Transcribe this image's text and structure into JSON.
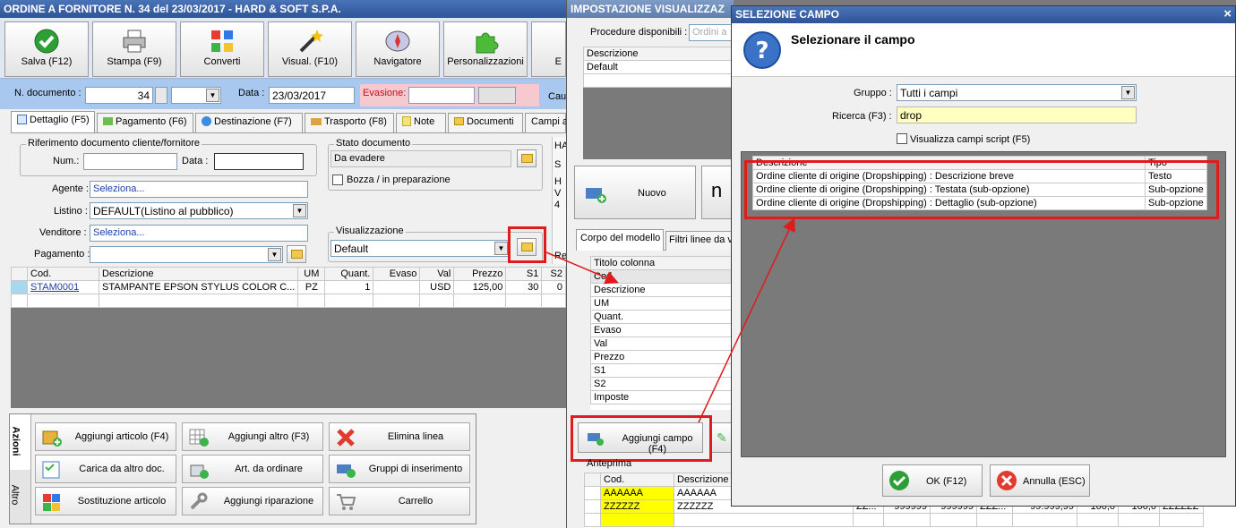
{
  "main_window": {
    "title": "ORDINE A FORNITORE N. 34 del 23/03/2017 - HARD & SOFT S.P.A.",
    "toolbar": {
      "save": "Salva (F12)",
      "print": "Stampa (F9)",
      "convert": "Converti",
      "visual": "Visual. (F10)",
      "navigator": "Navigatore",
      "custom": "Personalizzazioni",
      "extra": "E"
    },
    "header": {
      "doc_number_label": "N. documento :",
      "doc_number": "34",
      "date_label": "Data :",
      "date": "23/03/2017",
      "evasion_label": "Evasione:",
      "cau_label": "Cau"
    },
    "tabs": [
      "Dettaglio (F5)",
      "Pagamento (F6)",
      "Destinazione (F7)",
      "Trasporto (F8)",
      "Note",
      "Documenti",
      "Campi a"
    ],
    "ref_group": {
      "title": "Riferimento documento cliente/fornitore",
      "num_label": "Num.:",
      "date_label": "Data :"
    },
    "agente_label": "Agente :",
    "agente_value": "Seleziona...",
    "listino_label": "Listino :",
    "listino_value": "DEFAULT(Listino al pubblico)",
    "venditore_label": "Venditore :",
    "venditore_value": "Seleziona...",
    "pagamento_label": "Pagamento :",
    "stato": {
      "title": "Stato documento",
      "value": "Da evadere",
      "bozza": "Bozza / in preparazione"
    },
    "visualizzazione": {
      "title": "Visualizzazione",
      "value": "Default"
    },
    "side_labels": [
      "HA",
      "S",
      "H",
      "V",
      "4",
      "Re"
    ],
    "grid": {
      "columns": [
        "Cod.",
        "Descrizione",
        "UM",
        "Quant.",
        "Evaso",
        "Val",
        "Prezzo",
        "S1",
        "S2"
      ],
      "rows": [
        [
          "STAM0001",
          "STAMPANTE EPSON STYLUS COLOR C...",
          "PZ",
          "1",
          "",
          "USD",
          "125,00",
          "30",
          "0"
        ]
      ]
    },
    "actions": {
      "side_tabs": [
        "Azioni",
        "Altro"
      ],
      "buttons": [
        "Aggiungi articolo (F4)",
        "Aggiungi altro (F3)",
        "Elimina linea",
        "Carica da altro doc.",
        "Art. da ordinare",
        "Gruppi di inserimento",
        "Sostituzione articolo",
        "Aggiungi riparazione",
        "Carrello"
      ]
    }
  },
  "mid_window": {
    "title": "IMPOSTAZIONE VISUALIZZAZ",
    "procedures_label": "Procedure disponibili :",
    "procedures_value": "Ordini a",
    "list_header": "Descrizione",
    "list_items": [
      "Default"
    ],
    "new_button": "Nuovo",
    "n_button": "n",
    "tabs": [
      "Corpo del modello",
      "Filtri linee da v"
    ],
    "col_header": "Titolo colonna",
    "columns": [
      "Cod.",
      "Descrizione",
      "UM",
      "Quant.",
      "Evaso",
      "Val",
      "Prezzo",
      "S1",
      "S2",
      "Imposte"
    ],
    "add_field_button": "Aggiungi campo (F4)",
    "preview_label": "Anteprima",
    "preview": {
      "headers": [
        "Cod.",
        "Descrizione"
      ],
      "rows": [
        [
          "AAAAAA",
          "AAAAAA",
          "",
          "",
          "",
          "",
          "",
          "",
          "",
          ""
        ],
        [
          "ZZZZZZ",
          "ZZZZZZ",
          "ZZ...",
          "999999",
          "999999",
          "ZZZ...",
          "99.999,99",
          "100,0",
          "100,0",
          "ZZZZZZ"
        ]
      ]
    }
  },
  "dialog": {
    "title": "SELEZIONE CAMPO",
    "close": "×",
    "heading": "Selezionare il campo",
    "group_label": "Gruppo :",
    "group_value": "Tutti i campi",
    "search_label": "Ricerca (F3) :",
    "search_value": "drop",
    "script_checkbox": "Visualizza campi script (F5)",
    "list": {
      "headers": [
        "Descrizione",
        "Tipo"
      ],
      "rows": [
        [
          "Ordine cliente di origine (Dropshipping) : Descrizione breve",
          "Testo"
        ],
        [
          "Ordine cliente di origine (Dropshipping) : Testata (sub-opzione)",
          "Sub-opzione"
        ],
        [
          "Ordine cliente di origine (Dropshipping) : Dettaglio (sub-opzione)",
          "Sub-opzione"
        ]
      ]
    },
    "ok_button": "OK (F12)",
    "cancel_button": "Annulla (ESC)"
  },
  "colors": {
    "title_blue": "#3a5fa0",
    "header_blue": "#a9c8f0",
    "highlight_red": "#e01b1b",
    "yellow_input": "#ffffc0",
    "pink_field": "#f6c9d0"
  }
}
